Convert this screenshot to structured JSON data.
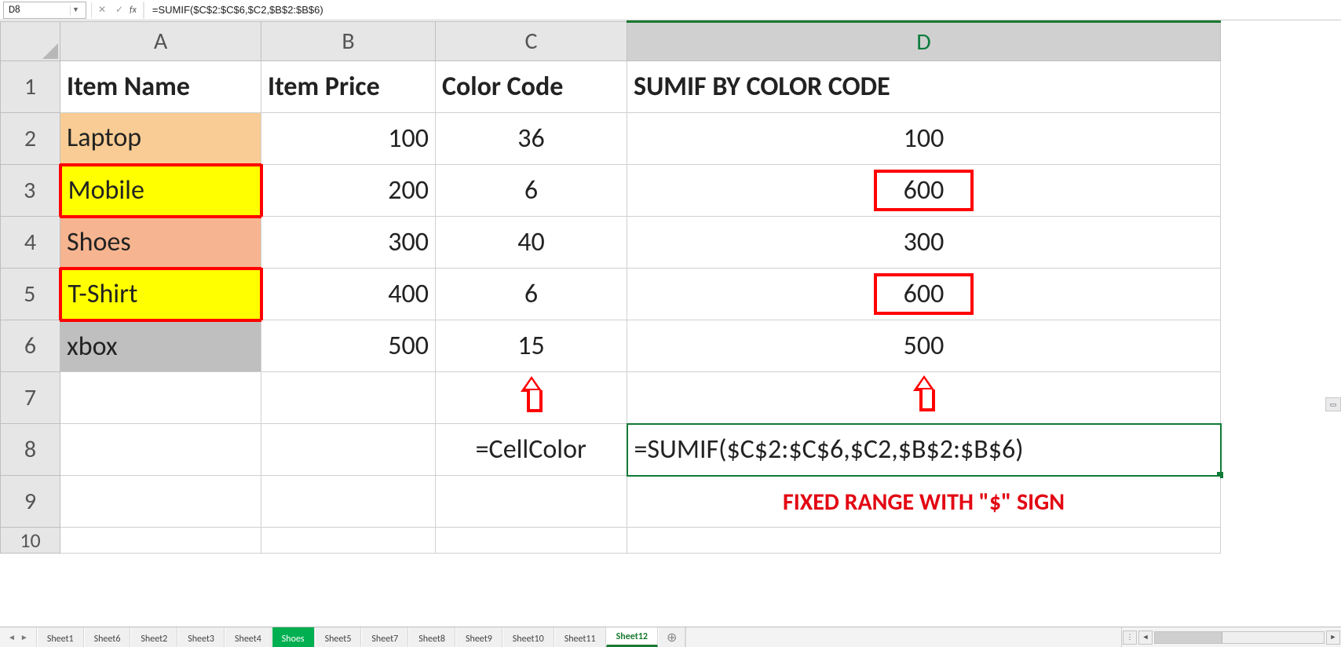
{
  "formula_bar": {
    "cell_ref": "D8",
    "fx_label": "fx",
    "formula": "=SUMIF($C$2:$C$6,$C2,$B$2:$B$6)"
  },
  "columns": [
    "A",
    "B",
    "C",
    "D"
  ],
  "row_numbers": [
    "1",
    "2",
    "3",
    "4",
    "5",
    "6",
    "7",
    "8",
    "9",
    "10"
  ],
  "headers": {
    "A": "Item Name",
    "B": "Item Price",
    "C": "Color Code",
    "D": "SUMIF BY COLOR CODE"
  },
  "rows": [
    {
      "item": "Laptop",
      "price": "100",
      "color": "36",
      "sum": "100",
      "fill": "fill-tan",
      "a_red": false,
      "d_red": false
    },
    {
      "item": "Mobile",
      "price": "200",
      "color": "6",
      "sum": "600",
      "fill": "fill-yellow",
      "a_red": true,
      "d_red": true
    },
    {
      "item": "Shoes",
      "price": "300",
      "color": "40",
      "sum": "300",
      "fill": "fill-salmon",
      "a_red": false,
      "d_red": false
    },
    {
      "item": "T-Shirt",
      "price": "400",
      "color": "6",
      "sum": "600",
      "fill": "fill-yellow",
      "a_red": true,
      "d_red": true
    },
    {
      "item": "xbox",
      "price": "500",
      "color": "15",
      "sum": "500",
      "fill": "fill-gray",
      "a_red": false,
      "d_red": false
    }
  ],
  "row8": {
    "C": "=CellColor",
    "D": "=SUMIF($C$2:$C$6,$C2,$B$2:$B$6)"
  },
  "row9": {
    "annotation": "FIXED RANGE WITH \"$\" SIGN"
  },
  "tabs": [
    "Sheet1",
    "Sheet6",
    "Sheet2",
    "Sheet3",
    "Sheet4",
    "Shoes",
    "Sheet5",
    "Sheet7",
    "Sheet8",
    "Sheet9",
    "Sheet10",
    "Sheet11",
    "Sheet12"
  ],
  "active_tab": "Sheet12",
  "green_tab": "Shoes",
  "chart_data": {
    "type": "table",
    "title": "SUMIF BY COLOR CODE",
    "columns": [
      "Item Name",
      "Item Price",
      "Color Code",
      "SUMIF BY COLOR CODE"
    ],
    "rows": [
      [
        "Laptop",
        100,
        36,
        100
      ],
      [
        "Mobile",
        200,
        6,
        600
      ],
      [
        "Shoes",
        300,
        40,
        300
      ],
      [
        "T-Shirt",
        400,
        6,
        600
      ],
      [
        "xbox",
        500,
        15,
        500
      ]
    ],
    "formulas": {
      "C8": "=CellColor",
      "D8": "=SUMIF($C$2:$C$6,$C2,$B$2:$B$6)"
    }
  }
}
